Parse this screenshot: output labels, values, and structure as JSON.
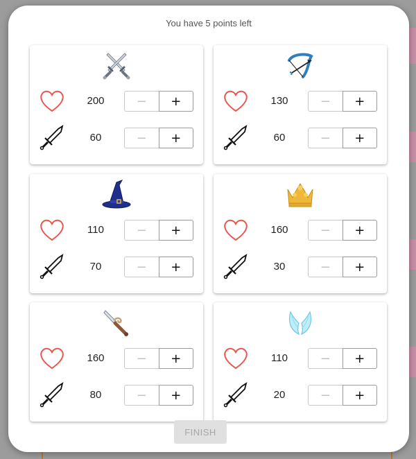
{
  "header": {
    "points_text": "You have 5 points left"
  },
  "controls": {
    "minus_label": "−",
    "plus_label": "+"
  },
  "characters": [
    {
      "portrait": "crossed-swords-icon",
      "health": "200",
      "attack": "60"
    },
    {
      "portrait": "bow-and-arrow-icon",
      "health": "130",
      "attack": "60"
    },
    {
      "portrait": "wizard-hat-icon",
      "health": "110",
      "attack": "70"
    },
    {
      "portrait": "crown-icon",
      "health": "160",
      "attack": "30"
    },
    {
      "portrait": "dagger-icon",
      "health": "160",
      "attack": "80"
    },
    {
      "portrait": "angel-wings-icon",
      "health": "110",
      "attack": "20"
    }
  ],
  "stat_icons": {
    "health": "heart-icon",
    "attack": "sword-icon"
  },
  "colors": {
    "heart": "#e8574c",
    "crown": "#f0b83a",
    "wizard_hat": "#1f2f8a",
    "wings": "#8fdcf0",
    "bow": "#2d7fc4"
  },
  "footer": {
    "finish_label": "FINISH"
  }
}
